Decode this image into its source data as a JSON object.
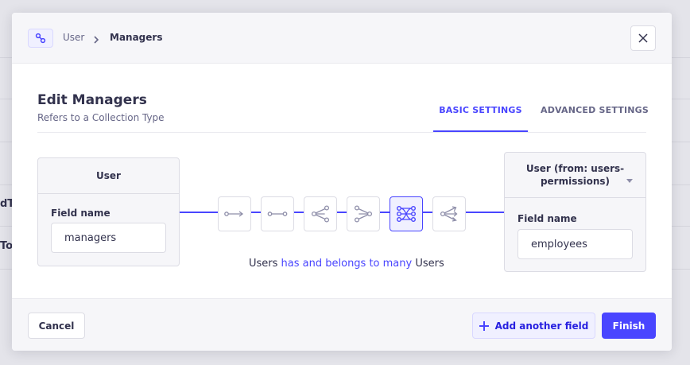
{
  "background": {
    "fragment_1": "dTo",
    "fragment_2": "Tok"
  },
  "header": {
    "breadcrumb_icon": "link-icon",
    "breadcrumb_parent": "User",
    "breadcrumb_current": "Managers",
    "close_icon": "close-icon"
  },
  "title": "Edit Managers",
  "subtitle": "Refers to a Collection Type",
  "tabs": {
    "basic": "BASIC SETTINGS",
    "advanced": "ADVANCED SETTINGS",
    "active": "basic"
  },
  "left_box": {
    "header": "User",
    "field_label": "Field name",
    "field_value": "managers"
  },
  "right_box": {
    "header": "User (from: users-permissions)",
    "field_label": "Field name",
    "field_value": "employees"
  },
  "relations": [
    {
      "name": "one-way",
      "icon": "one-way-icon"
    },
    {
      "name": "one-to-one",
      "icon": "one-to-one-icon"
    },
    {
      "name": "one-to-many",
      "icon": "one-to-many-icon"
    },
    {
      "name": "many-to-one",
      "icon": "many-to-one-icon"
    },
    {
      "name": "many-to-many",
      "icon": "many-to-many-icon",
      "active": true
    },
    {
      "name": "many-way",
      "icon": "many-way-icon"
    }
  ],
  "relation_text": {
    "left": "Users",
    "middle": "has and belongs to many",
    "right": "Users"
  },
  "footer": {
    "cancel": "Cancel",
    "add_field": "Add another field",
    "finish": "Finish"
  },
  "colors": {
    "primary": "#4945ff",
    "text": "#32324d",
    "muted": "#666687"
  }
}
